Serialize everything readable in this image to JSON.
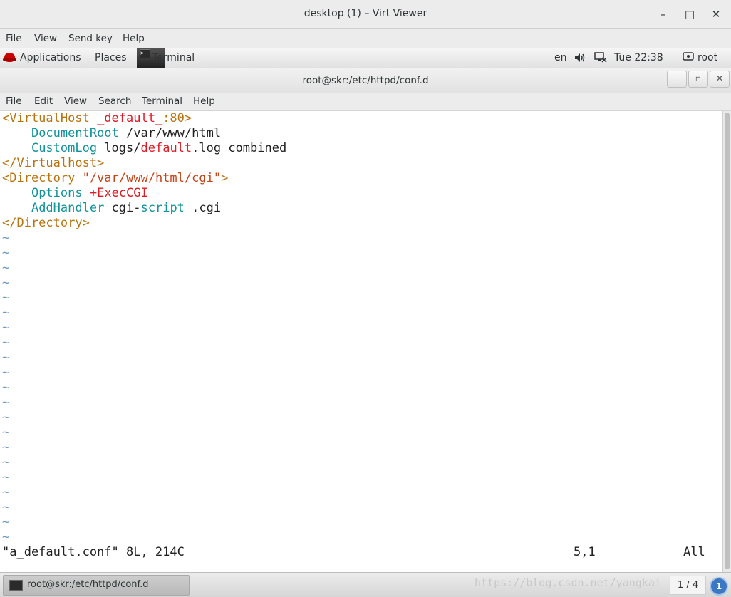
{
  "outer_window": {
    "title": "desktop (1) – Virt Viewer",
    "controls": {
      "minimize": "–",
      "maximize": "□",
      "close": "✕"
    },
    "menu": [
      "File",
      "View",
      "Send key",
      "Help"
    ]
  },
  "top_panel": {
    "applications": "Applications",
    "places": "Places",
    "task": "Terminal",
    "language": "en",
    "clock": "Tue 22:38",
    "user": "root"
  },
  "terminal_window": {
    "title": "root@skr:/etc/httpd/conf.d",
    "controls": {
      "minimize": "_",
      "maximize": "▫",
      "close": "✕"
    },
    "menu": [
      "File",
      "Edit",
      "View",
      "Search",
      "Terminal",
      "Help"
    ]
  },
  "editor": {
    "lines": [
      [
        "<VirtualHost ",
        "_default_",
        ":80>"
      ],
      [
        "    ",
        "DocumentRoot",
        " /var/www/html"
      ],
      [
        "    ",
        "CustomLog",
        " logs/",
        "default",
        ".log combined"
      ],
      [
        "</Virtualhost>"
      ],
      [
        "<Directory ",
        "\"/var/www/html/cgi\"",
        ">"
      ],
      [
        "    ",
        "Options",
        " ",
        "+ExecCGI"
      ],
      [
        "    ",
        "AddHandler",
        " cgi-",
        "script",
        " .cgi"
      ],
      [
        "</Directory>"
      ]
    ],
    "tilde": "~",
    "status_file": "\"a_default.conf\" 8L, 214C",
    "status_pos": "5,1",
    "status_view": "All"
  },
  "taskbar": {
    "task": "root@skr:/etc/httpd/conf.d",
    "watermark": "https://blog.csdn.net/yangkai",
    "pager": "1 / 4",
    "notifications": "1"
  },
  "colors": {
    "tag": "#b8740f",
    "keyword": "#e01b24",
    "directive": "#12939a",
    "tilde": "#6f97c3"
  },
  "icons": [
    "redhat-icon",
    "volume-icon",
    "network-icon",
    "user-icon",
    "terminal-icon",
    "notification-icon"
  ]
}
